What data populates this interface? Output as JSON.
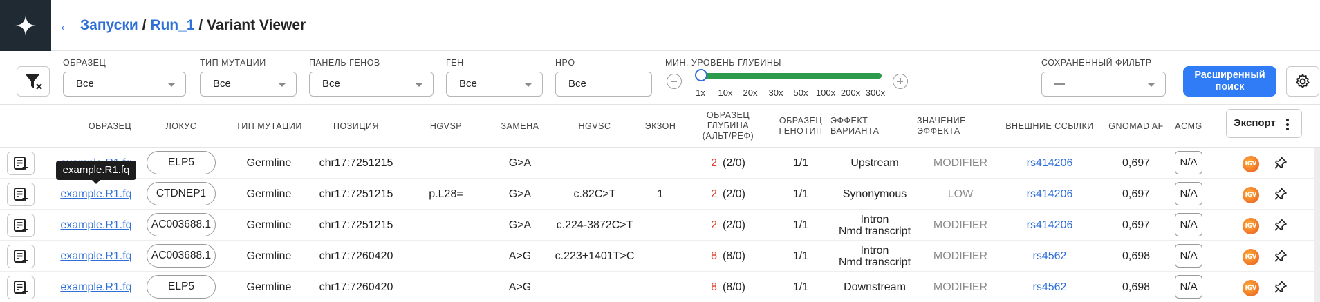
{
  "header": {
    "back_icon": "arrow-left-icon",
    "breadcrumb": [
      {
        "label": "Запуски"
      },
      {
        "label": "Run_1"
      },
      {
        "label": "Variant Viewer"
      }
    ],
    "separator": "/"
  },
  "filters": {
    "sample": {
      "label": "ОБРАЗЕЦ",
      "value": "Все"
    },
    "mutation_type": {
      "label": "ТИП МУТАЦИИ",
      "value": "Все"
    },
    "gene_panel": {
      "label": "ПАНЕЛЬ ГЕНОВ",
      "value": "Все"
    },
    "gene": {
      "label": "ГЕН",
      "value": "Все"
    },
    "hpo": {
      "label": "HPO",
      "value": "Все"
    },
    "depth": {
      "label": "МИН. УРОВЕНЬ ГЛУБИНЫ",
      "ticks": [
        "1x",
        "10x",
        "20x",
        "30x",
        "50x",
        "100x",
        "200x",
        "300x"
      ],
      "selected_index": 0
    },
    "saved_filter": {
      "label": "СОХРАНЕННЫЙ ФИЛЬТР",
      "value": "—"
    },
    "advanced_search_line1": "Расширенный",
    "advanced_search_line2": "поиск"
  },
  "table": {
    "headers": {
      "sample": "ОБРАЗЕЦ",
      "locus": "ЛОКУС",
      "mutation_type": "ТИП МУТАЦИИ",
      "position": "ПОЗИЦИЯ",
      "hgvsp": "HGVSP",
      "substitution": "ЗАМЕНА",
      "hgvsc": "HGVSC",
      "exon": "ЭКЗОН",
      "depth_l1": "ОБРАЗЕЦ",
      "depth_l2": "ГЛУБИНА",
      "depth_l3": "(АЛЬТ/РЕФ)",
      "genotype_l1": "ОБРАЗЕЦ",
      "genotype_l2": "ГЕНОТИП",
      "effect_l1": "ЭФФЕКТ",
      "effect_l2": "ВАРИАНТА",
      "impact_l1": "ЗНАЧЕНИЕ",
      "impact_l2": "ЭФФЕКТА",
      "external": "ВНЕШНИЕ ССЫЛКИ",
      "gnomad": "GNOMAD AF",
      "acmg": "ACMG"
    },
    "export_label": "Экспорт",
    "rows": [
      {
        "sample": "example.R1.fq",
        "locus": "ELP5",
        "mutation_type": "Germline",
        "position": "chr17:7251215",
        "hgvsp": "",
        "substitution": "G>A",
        "hgvsc": "",
        "exon": "",
        "depth_alt": "2",
        "depth_ratio": "(2/0)",
        "genotype": "1/1",
        "effect_l1": "Upstream",
        "effect_l2": "",
        "impact": "MODIFIER",
        "external": "rs414206",
        "gnomad": "0,697",
        "acmg": "N/A"
      },
      {
        "sample": "example.R1.fq",
        "locus": "CTDNEP1",
        "mutation_type": "Germline",
        "position": "chr17:7251215",
        "hgvsp": "p.L28=",
        "substitution": "G>A",
        "hgvsc": "c.82C>T",
        "exon": "1",
        "depth_alt": "2",
        "depth_ratio": "(2/0)",
        "genotype": "1/1",
        "effect_l1": "Synonymous",
        "effect_l2": "",
        "impact": "LOW",
        "external": "rs414206",
        "gnomad": "0,697",
        "acmg": "N/A"
      },
      {
        "sample": "example.R1.fq",
        "locus": "AC003688.1",
        "mutation_type": "Germline",
        "position": "chr17:7251215",
        "hgvsp": "",
        "substitution": "G>A",
        "hgvsc": "c.224-3872C>T",
        "exon": "",
        "depth_alt": "2",
        "depth_ratio": "(2/0)",
        "genotype": "1/1",
        "effect_l1": "Intron",
        "effect_l2": "Nmd transcript",
        "impact": "MODIFIER",
        "external": "rs414206",
        "gnomad": "0,697",
        "acmg": "N/A"
      },
      {
        "sample": "example.R1.fq",
        "locus": "AC003688.1",
        "mutation_type": "Germline",
        "position": "chr17:7260420",
        "hgvsp": "",
        "substitution": "A>G",
        "hgvsc": "c.223+1401T>C",
        "exon": "",
        "depth_alt": "8",
        "depth_ratio": "(8/0)",
        "genotype": "1/1",
        "effect_l1": "Intron",
        "effect_l2": "Nmd transcript",
        "impact": "MODIFIER",
        "external": "rs4562",
        "gnomad": "0,698",
        "acmg": "N/A"
      },
      {
        "sample": "example.R1.fq",
        "locus": "ELP5",
        "mutation_type": "Germline",
        "position": "chr17:7260420",
        "hgvsp": "",
        "substitution": "A>G",
        "hgvsc": "",
        "exon": "",
        "depth_alt": "8",
        "depth_ratio": "(8/0)",
        "genotype": "1/1",
        "effect_l1": "Downstream",
        "effect_l2": "",
        "impact": "MODIFIER",
        "external": "rs4562",
        "gnomad": "0,698",
        "acmg": "N/A"
      }
    ],
    "igv_label": "IGV"
  },
  "tooltip": {
    "text": "example.R1.fq"
  },
  "colors": {
    "brand_dark": "#1f2a33",
    "accent": "#2f7cf6",
    "link": "#2f6fd8",
    "depth_red": "#e0402c",
    "slider_green": "#2e9a4c"
  }
}
